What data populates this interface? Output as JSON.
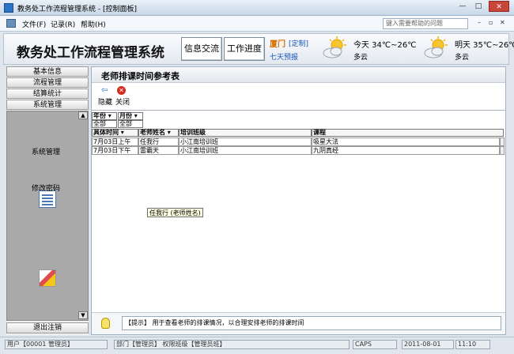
{
  "window": {
    "title": "教务处工作流程管理系统 - [控制面板]",
    "minimize": "—",
    "maximize": "□",
    "close": "✕"
  },
  "menu": {
    "file": "文件(F)",
    "records": "记录(R)",
    "help": "帮助(H)",
    "help_search_placeholder": "键入需要帮助的问题",
    "mdi_min": "–",
    "mdi_max": "▫",
    "mdi_close": "✕"
  },
  "header": {
    "app_title": "教务处工作流程管理系统",
    "btn_info": "信息交流",
    "btn_progress": "工作进度",
    "city": "厦门",
    "customize": "[定制]",
    "forecast": "七天预报",
    "today_label": "今天 34℃~26℃",
    "today_cond": "多云",
    "tomorrow_label": "明天 35℃~26℃",
    "tomorrow_cond": "多云"
  },
  "nav": {
    "groups": [
      "基本信息",
      "流程管理",
      "结算统计",
      "系统管理"
    ],
    "tools": [
      {
        "label": "系统管理",
        "icon": "checklist-icon"
      },
      {
        "label": "修改密码",
        "icon": "pencil-icon"
      }
    ],
    "exit": "退出注销",
    "scroll_up": "▲",
    "scroll_down": "▼"
  },
  "panel": {
    "title": "老师排课时间参考表",
    "hide_label": "隐藏",
    "close_label": "关闭",
    "hide_icon": "⇦",
    "close_icon": "✕"
  },
  "filters": {
    "year_header": "年份 ▾",
    "month_header": "月份 ▾",
    "year_value": "全部",
    "month_value": "全部"
  },
  "table": {
    "columns": [
      "具体时间 ▾",
      "老师姓名 ▾",
      "培训班级",
      "课程"
    ],
    "rows": [
      [
        "7月03日上午",
        "任我行",
        "小江南培训班",
        "吸星大法"
      ],
      [
        "7月03日下午",
        "雷霸天",
        "小江南培训班",
        "九阴真经"
      ]
    ]
  },
  "tooltip": "任我行 (老师姓名)",
  "hint": "【提示】 用于查看老师的排课情况，以合理安排老师的排课时间",
  "status": {
    "user": "用户【00001 管理员】",
    "dept": "部门【管理员】  权限班级【管理员班】",
    "caps": "CAPS",
    "date": "2011-08-01",
    "time": "11:10"
  }
}
